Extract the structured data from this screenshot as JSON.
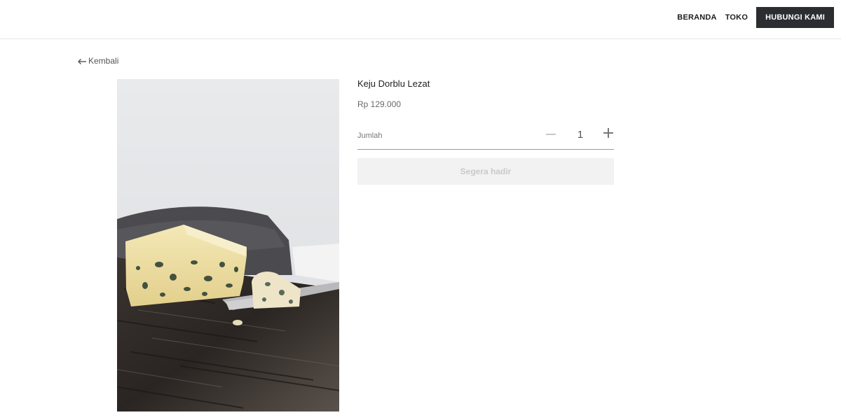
{
  "nav": {
    "home_label": "BERANDA",
    "shop_label": "TOKO",
    "contact_label": "HUBUNGI KAMI"
  },
  "back": {
    "label": "Kembali",
    "icon": "arrow-left-icon"
  },
  "product": {
    "image_icon": "cheese-photo",
    "title": "Keju Dorblu Lezat",
    "price": "Rp 129.000",
    "quantity": {
      "label": "Jumlah",
      "value": "1",
      "minus_icon": "minus-icon",
      "plus_icon": "plus-icon"
    },
    "action_label": "Segera hadir"
  },
  "colors": {
    "cta_bg": "#2b2d31",
    "button_disabled_bg": "#f2f2f2",
    "button_disabled_text": "#c9c9c9"
  }
}
